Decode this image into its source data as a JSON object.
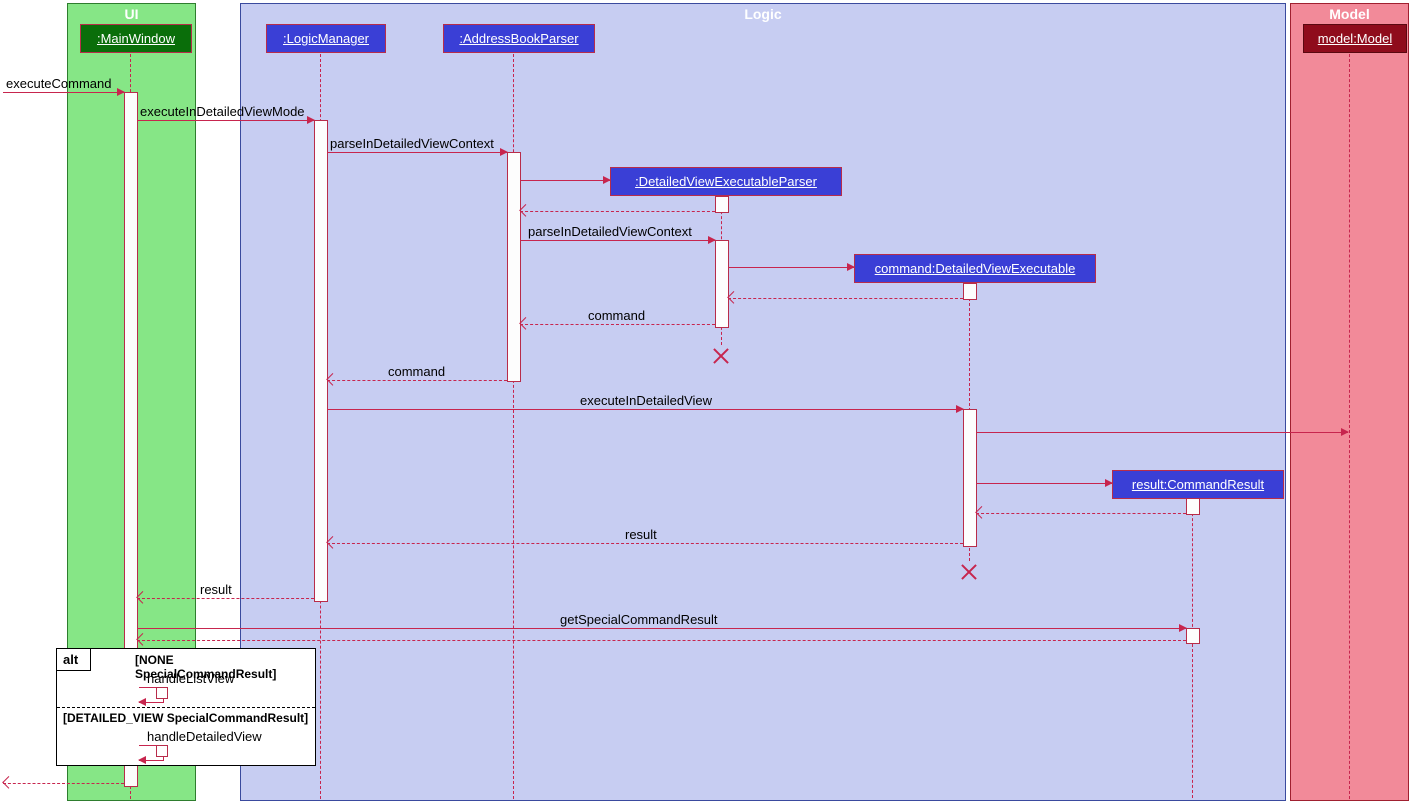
{
  "regions": {
    "ui": "UI",
    "logic": "Logic",
    "model": "Model"
  },
  "participants": {
    "mainwindow": ":MainWindow",
    "logicmanager": ":LogicManager",
    "addressbookparser": ":AddressBookParser",
    "dvep": ":DetailedViewExecutableParser",
    "cmd_dve": "command:DetailedViewExecutable",
    "result_cr": "result:CommandResult",
    "model_model": "model:Model"
  },
  "messages": {
    "executeCommand": "executeCommand",
    "executeInDetailedViewMode": "executeInDetailedViewMode",
    "parseInDetailedViewContext1": "parseInDetailedViewContext",
    "parseInDetailedViewContext2": "parseInDetailedViewContext",
    "command1": "command",
    "command2": "command",
    "executeInDetailedView": "executeInDetailedView",
    "result1": "result",
    "result2": "result",
    "getSpecialCommandResult": "getSpecialCommandResult"
  },
  "alt": {
    "label": "alt",
    "guard1": "[NONE SpecialCommandResult]",
    "msg1": "handleListView",
    "guard2": "[DETAILED_VIEW SpecialCommandResult]",
    "msg2": "handleDetailedView"
  }
}
